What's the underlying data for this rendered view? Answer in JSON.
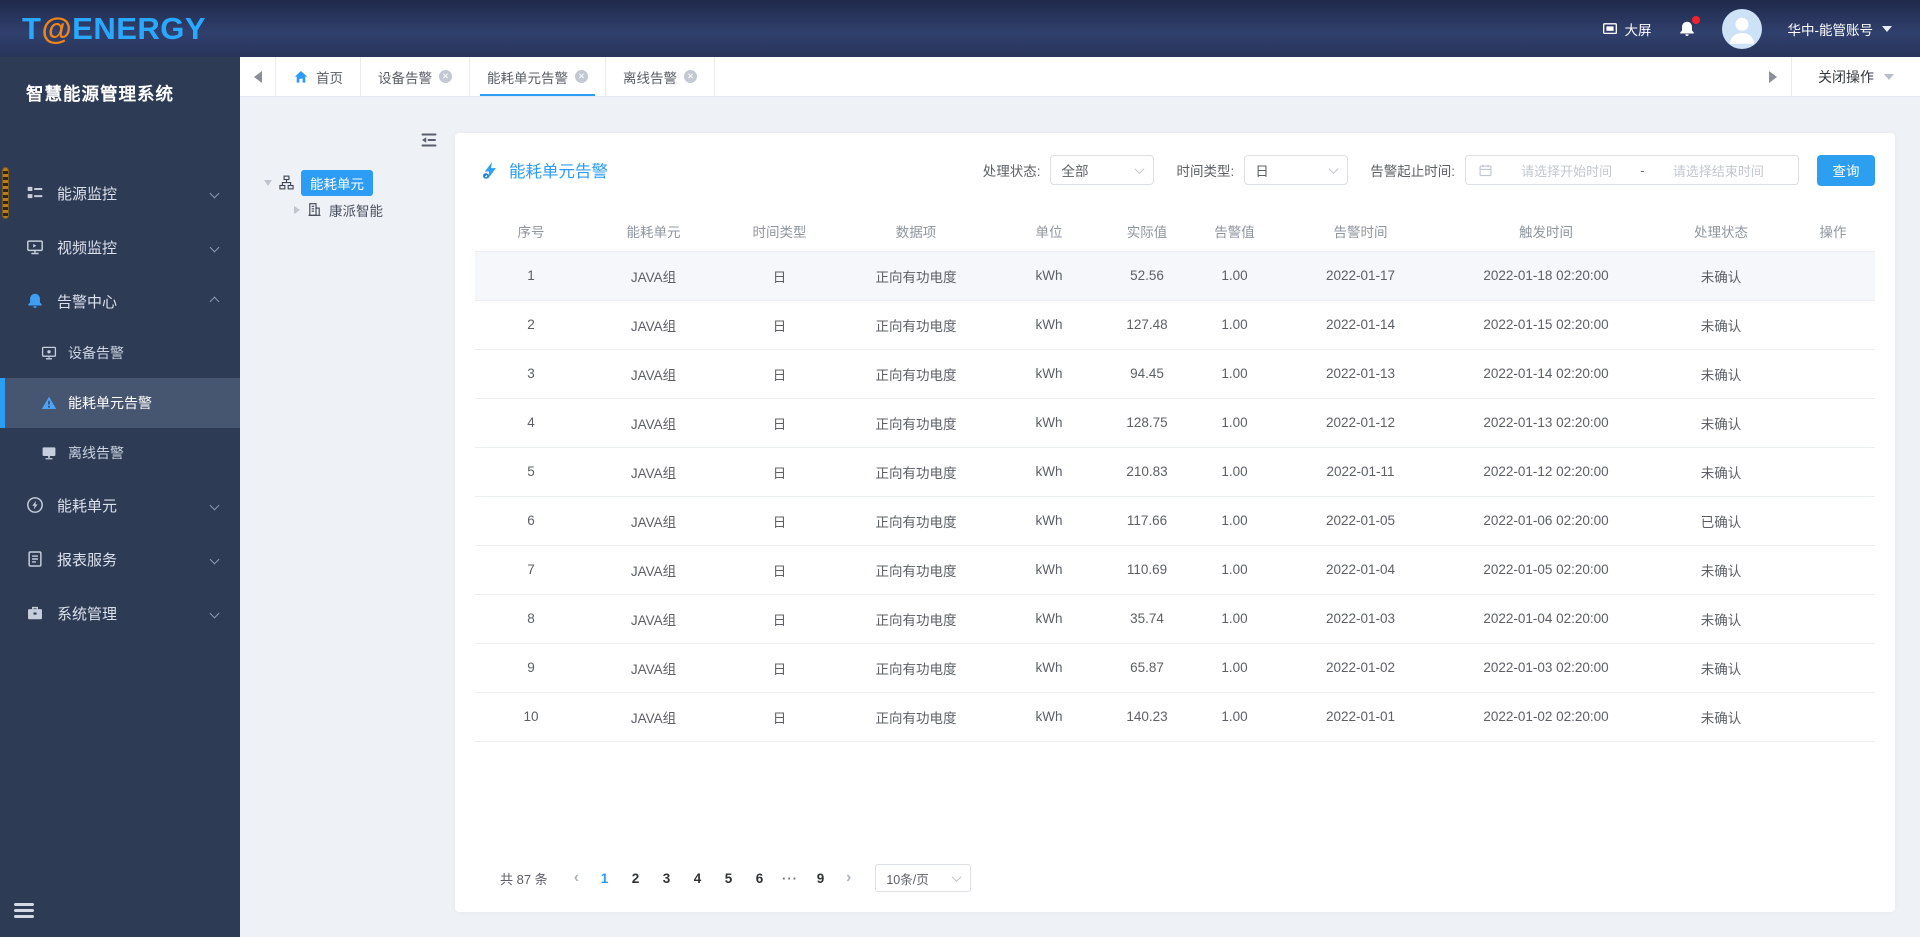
{
  "colors": {
    "primary": "#2d9cf4",
    "header_bg": "#273256",
    "sidebar_bg": "#2d3b54",
    "sidebar_active_bg": "#475670",
    "logo_blue": "#29a8ff",
    "logo_orange": "#f08519",
    "badge_red": "#f5222d",
    "table_border": "#ebeef5",
    "text_secondary": "#606266"
  },
  "header": {
    "logo_t": "T",
    "logo_at": "@",
    "logo_rest": "ENERGY",
    "big_screen_label": "大屏",
    "account_name": "华中-能管账号"
  },
  "sidebar": {
    "system_title": "智慧能源管理系统",
    "items": [
      {
        "name": "energy-monitor",
        "label": "能源监控",
        "icon": "energy-monitor-icon",
        "type": "top"
      },
      {
        "name": "video-monitor",
        "label": "视频监控",
        "icon": "video-monitor-icon",
        "type": "top"
      },
      {
        "name": "alarm-center",
        "label": "告警中心",
        "icon": "alarm-bell-icon",
        "type": "top",
        "expanded": true
      },
      {
        "name": "device-alarm",
        "label": "设备告警",
        "icon": "device-alarm-icon",
        "type": "sub"
      },
      {
        "name": "energy-unit-alarm",
        "label": "能耗单元告警",
        "icon": "warning-triangle-icon",
        "type": "sub",
        "active": true
      },
      {
        "name": "offline-alarm",
        "label": "离线告警",
        "icon": "offline-monitor-icon",
        "type": "sub"
      },
      {
        "name": "energy-unit",
        "label": "能耗单元",
        "icon": "bolt-circle-icon",
        "type": "top"
      },
      {
        "name": "report-service",
        "label": "报表服务",
        "icon": "report-icon",
        "type": "top"
      },
      {
        "name": "system-management",
        "label": "系统管理",
        "icon": "system-icon",
        "type": "top"
      }
    ]
  },
  "tabbar": {
    "tabs": [
      {
        "name": "home",
        "label": "首页",
        "home": true,
        "closable": false,
        "active": false
      },
      {
        "name": "device-alarm",
        "label": "设备告警",
        "home": false,
        "closable": true,
        "active": false
      },
      {
        "name": "energy-unit-alarm",
        "label": "能耗单元告警",
        "home": false,
        "closable": true,
        "active": true
      },
      {
        "name": "offline-alarm",
        "label": "离线告警",
        "home": false,
        "closable": true,
        "active": false
      }
    ],
    "close_ops_label": "关闭操作"
  },
  "tree": {
    "root_label": "能耗单元",
    "child_label": "康派智能"
  },
  "panel": {
    "title": "能耗单元告警",
    "filters": {
      "status_label": "处理状态:",
      "status_value": "全部",
      "time_type_label": "时间类型:",
      "time_type_value": "日",
      "range_label": "告警起止时间:",
      "start_placeholder": "请选择开始时间",
      "range_separator": "-",
      "end_placeholder": "请选择结束时间",
      "search_label": "查询"
    },
    "table": {
      "columns": [
        "序号",
        "能耗单元",
        "时间类型",
        "数据项",
        "单位",
        "实际值",
        "告警值",
        "告警时间",
        "触发时间",
        "处理状态",
        "操作"
      ],
      "rows": [
        [
          "1",
          "JAVA组",
          "日",
          "正向有功电度",
          "kWh",
          "52.56",
          "1.00",
          "2022-01-17",
          "2022-01-18 02:20:00",
          "未确认",
          ""
        ],
        [
          "2",
          "JAVA组",
          "日",
          "正向有功电度",
          "kWh",
          "127.48",
          "1.00",
          "2022-01-14",
          "2022-01-15 02:20:00",
          "未确认",
          ""
        ],
        [
          "3",
          "JAVA组",
          "日",
          "正向有功电度",
          "kWh",
          "94.45",
          "1.00",
          "2022-01-13",
          "2022-01-14 02:20:00",
          "未确认",
          ""
        ],
        [
          "4",
          "JAVA组",
          "日",
          "正向有功电度",
          "kWh",
          "128.75",
          "1.00",
          "2022-01-12",
          "2022-01-13 02:20:00",
          "未确认",
          ""
        ],
        [
          "5",
          "JAVA组",
          "日",
          "正向有功电度",
          "kWh",
          "210.83",
          "1.00",
          "2022-01-11",
          "2022-01-12 02:20:00",
          "未确认",
          ""
        ],
        [
          "6",
          "JAVA组",
          "日",
          "正向有功电度",
          "kWh",
          "117.66",
          "1.00",
          "2022-01-05",
          "2022-01-06 02:20:00",
          "已确认",
          ""
        ],
        [
          "7",
          "JAVA组",
          "日",
          "正向有功电度",
          "kWh",
          "110.69",
          "1.00",
          "2022-01-04",
          "2022-01-05 02:20:00",
          "未确认",
          ""
        ],
        [
          "8",
          "JAVA组",
          "日",
          "正向有功电度",
          "kWh",
          "35.74",
          "1.00",
          "2022-01-03",
          "2022-01-04 02:20:00",
          "未确认",
          ""
        ],
        [
          "9",
          "JAVA组",
          "日",
          "正向有功电度",
          "kWh",
          "65.87",
          "1.00",
          "2022-01-02",
          "2022-01-03 02:20:00",
          "未确认",
          ""
        ],
        [
          "10",
          "JAVA组",
          "日",
          "正向有功电度",
          "kWh",
          "140.23",
          "1.00",
          "2022-01-01",
          "2022-01-02 02:20:00",
          "未确认",
          ""
        ]
      ]
    },
    "pagination": {
      "total_label": "共 87 条",
      "prev_label": "‹",
      "next_label": "›",
      "pages": [
        "1",
        "2",
        "3",
        "4",
        "5",
        "6",
        "···",
        "9"
      ],
      "active_page": "1",
      "page_size_label": "10条/页"
    }
  }
}
